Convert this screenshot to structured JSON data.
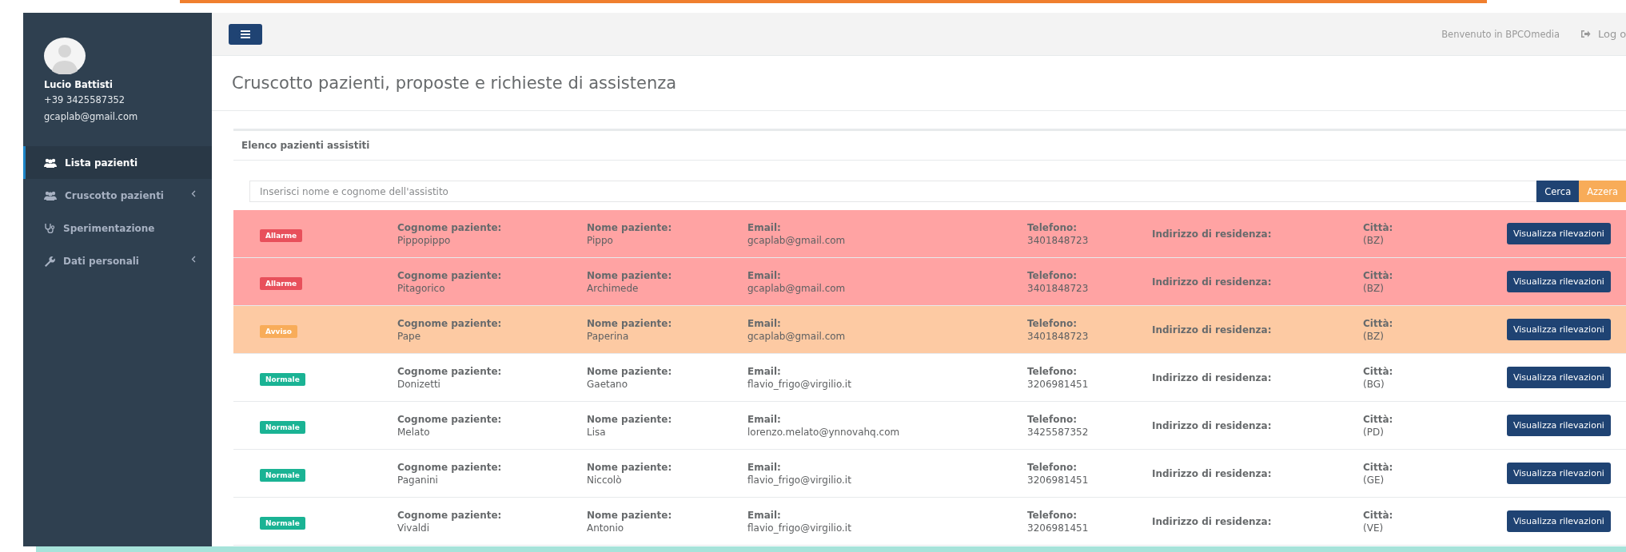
{
  "user": {
    "name": "Lucio Battisti",
    "phone": "+39 3425587352",
    "email": "gcaplab@gmail.com"
  },
  "sidebar": {
    "items": [
      {
        "label": "Lista pazienti",
        "selected": true,
        "submenu": false
      },
      {
        "label": "Cruscotto pazienti",
        "selected": false,
        "submenu": true
      },
      {
        "label": "Sperimentazione",
        "selected": false,
        "submenu": false
      },
      {
        "label": "Dati personali",
        "selected": false,
        "submenu": true
      }
    ]
  },
  "topbar": {
    "welcome": "Benvenuto in BPCOmedia",
    "logout": "Log o"
  },
  "page_title": "Cruscotto pazienti, proposte e richieste di assistenza",
  "panel": {
    "title": "Elenco pazienti assistiti",
    "search": {
      "placeholder": "Inserisci nome e cognome dell'assistito",
      "buttons": [
        {
          "label": "Cerca",
          "kind": "primary"
        },
        {
          "label": "Azzera",
          "kind": "warning"
        }
      ]
    },
    "rows": [
      {
        "status": {
          "kind": "alarm",
          "label": "Allarme"
        },
        "fields": [
          {
            "label": "Cognome paziente:",
            "value": "Pippopippo"
          },
          {
            "label": "Nome paziente:",
            "value": "Pippo"
          },
          {
            "label": "Email:",
            "value": "gcaplab@gmail.com"
          },
          {
            "label": "Telefono:",
            "value": "3401848723"
          },
          {
            "label": "Indirizzo di residenza:"
          },
          {
            "label": "Città:",
            "value": "(BZ)"
          }
        ],
        "button": "Visualizza rilevazioni"
      },
      {
        "status": {
          "kind": "alarm",
          "label": "Allarme"
        },
        "fields": [
          {
            "label": "Cognome paziente:",
            "value": "Pitagorico"
          },
          {
            "label": "Nome paziente:",
            "value": "Archimede"
          },
          {
            "label": "Email:",
            "value": "gcaplab@gmail.com"
          },
          {
            "label": "Telefono:",
            "value": "3401848723"
          },
          {
            "label": "Indirizzo di residenza:"
          },
          {
            "label": "Città:",
            "value": "(BZ)"
          }
        ],
        "button": "Visualizza rilevazioni"
      },
      {
        "status": {
          "kind": "warning",
          "label": "Avviso"
        },
        "fields": [
          {
            "label": "Cognome paziente:",
            "value": "Pape"
          },
          {
            "label": "Nome paziente:",
            "value": "Paperina"
          },
          {
            "label": "Email:",
            "value": "gcaplab@gmail.com"
          },
          {
            "label": "Telefono:",
            "value": "3401848723"
          },
          {
            "label": "Indirizzo di residenza:"
          },
          {
            "label": "Città:",
            "value": "(BZ)"
          }
        ],
        "button": "Visualizza rilevazioni"
      },
      {
        "status": {
          "kind": "normal",
          "label": "Normale"
        },
        "fields": [
          {
            "label": "Cognome paziente:",
            "value": "Donizetti"
          },
          {
            "label": "Nome paziente:",
            "value": "Gaetano"
          },
          {
            "label": "Email:",
            "value": "flavio_frigo@virgilio.it"
          },
          {
            "label": "Telefono:",
            "value": "3206981451"
          },
          {
            "label": "Indirizzo di residenza:"
          },
          {
            "label": "Città:",
            "value": "(BG)"
          }
        ],
        "button": "Visualizza rilevazioni"
      },
      {
        "status": {
          "kind": "normal",
          "label": "Normale"
        },
        "fields": [
          {
            "label": "Cognome paziente:",
            "value": "Melato"
          },
          {
            "label": "Nome paziente:",
            "value": "Lisa"
          },
          {
            "label": "Email:",
            "value": "lorenzo.melato@ynnovahq.com"
          },
          {
            "label": "Telefono:",
            "value": "3425587352"
          },
          {
            "label": "Indirizzo di residenza:"
          },
          {
            "label": "Città:",
            "value": "(PD)"
          }
        ],
        "button": "Visualizza rilevazioni"
      },
      {
        "status": {
          "kind": "normal",
          "label": "Normale"
        },
        "fields": [
          {
            "label": "Cognome paziente:",
            "value": "Paganini"
          },
          {
            "label": "Nome paziente:",
            "value": "Niccolò"
          },
          {
            "label": "Email:",
            "value": "flavio_frigo@virgilio.it"
          },
          {
            "label": "Telefono:",
            "value": "3206981451"
          },
          {
            "label": "Indirizzo di residenza:"
          },
          {
            "label": "Città:",
            "value": "(GE)"
          }
        ],
        "button": "Visualizza rilevazioni"
      },
      {
        "status": {
          "kind": "normal",
          "label": "Normale"
        },
        "fields": [
          {
            "label": "Cognome paziente:",
            "value": "Vivaldi"
          },
          {
            "label": "Nome paziente:",
            "value": "Antonio"
          },
          {
            "label": "Email:",
            "value": "flavio_frigo@virgilio.it"
          },
          {
            "label": "Telefono:",
            "value": "3206981451"
          },
          {
            "label": "Indirizzo di residenza:"
          },
          {
            "label": "Città:",
            "value": "(VE)"
          }
        ],
        "button": "Visualizza rilevazioni"
      }
    ]
  }
}
